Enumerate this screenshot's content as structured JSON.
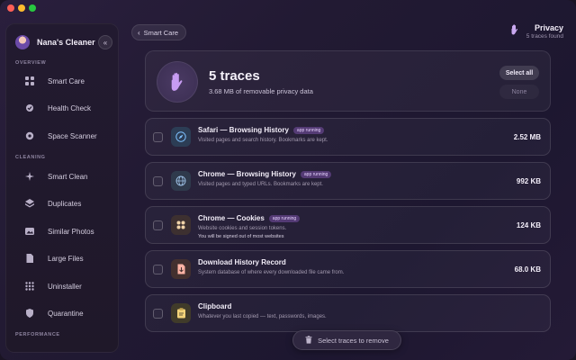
{
  "app": {
    "name": "Nana's Cleaner"
  },
  "sidebar": {
    "sections": {
      "overview": "OVERVIEW",
      "cleaning": "CLEANING",
      "performance": "PERFORMANCE"
    },
    "items": [
      {
        "label": "Smart Care",
        "icon": "grid-icon"
      },
      {
        "label": "Health Check",
        "icon": "stethoscope-icon"
      },
      {
        "label": "Space Scanner",
        "icon": "disk-icon"
      },
      {
        "label": "Smart Clean",
        "icon": "sparkle-icon"
      },
      {
        "label": "Duplicates",
        "icon": "layers-icon"
      },
      {
        "label": "Similar Photos",
        "icon": "photo-icon"
      },
      {
        "label": "Large Files",
        "icon": "file-icon"
      },
      {
        "label": "Uninstaller",
        "icon": "apps-grid-icon"
      },
      {
        "label": "Quarantine",
        "icon": "shield-icon"
      }
    ]
  },
  "header": {
    "back_label": "Smart Care",
    "title": "Privacy",
    "subtitle": "5 traces found"
  },
  "summary": {
    "count": "5 traces",
    "size_text": "3.68 MB of removable privacy data",
    "select_all": "Select all",
    "none": "None"
  },
  "traces": [
    {
      "title": "Safari — Browsing History",
      "badge": "app running",
      "desc": "Visited pages and search history. Bookmarks are kept.",
      "warn": "",
      "size": "2.52 MB",
      "icon": "safari-compass-icon"
    },
    {
      "title": "Chrome — Browsing History",
      "badge": "app running",
      "desc": "Visited pages and typed URLs. Bookmarks are kept.",
      "warn": "",
      "size": "992 KB",
      "icon": "globe-icon"
    },
    {
      "title": "Chrome — Cookies",
      "badge": "app running",
      "desc": "Website cookies and session tokens.",
      "warn": "You will be signed out of most websites",
      "size": "124 KB",
      "icon": "cookie-icon"
    },
    {
      "title": "Download History Record",
      "badge": "",
      "desc": "System database of where every downloaded file came from.",
      "warn": "",
      "size": "68.0 KB",
      "icon": "download-doc-icon"
    },
    {
      "title": "Clipboard",
      "badge": "",
      "desc": "Whatever you last copied — text, passwords, images.",
      "warn": "",
      "size": "",
      "icon": "clipboard-icon"
    }
  ],
  "footer": {
    "remove_label": "Select traces to remove"
  },
  "colors": {
    "accent": "#a86ee6",
    "background": "#221a33"
  }
}
